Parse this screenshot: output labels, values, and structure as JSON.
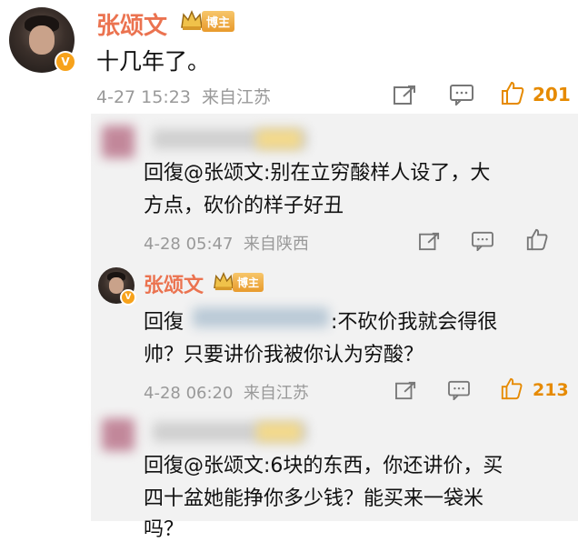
{
  "post": {
    "author": "张颂文",
    "badge": "博主",
    "verified_mark": "V",
    "content": "十几年了。",
    "meta": "4-27 15:23  来自江苏",
    "like_count": "201"
  },
  "replies": [
    {
      "author_blurred": true,
      "content": "回复@张颂文:别在立穷酸样人设了，大方点，砍价的样子好丑",
      "content_line1": "回復@张颂文:别在立穷酸样人设了，大",
      "content_line2": "方点，砍价的样子好丑",
      "meta": "4-28 05:47  来自陕西",
      "like_count": ""
    },
    {
      "author": "张颂文",
      "badge": "博主",
      "verified_mark": "V",
      "content_line1_prefix": "回復",
      "content_line1_suffix": ":不砍价我就会得很",
      "content_line2": "帅？只要讲价我被你认为穷酸？",
      "meta": "4-28 06:20  来自江苏",
      "like_count": "213"
    },
    {
      "author_blurred": true,
      "content_line1": "回復@张颂文:6块的东西，你还讲价，买",
      "content_line2": "四十盆她能挣你多少钱？能买来一袋米",
      "content_line3": "吗？"
    }
  ],
  "icons": {
    "share": "share-icon",
    "comment": "comment-icon",
    "like": "thumbs-up-icon",
    "crown": "crown-icon"
  },
  "colors": {
    "name": "#eb7350",
    "like_active": "#e68a00",
    "meta": "#999999",
    "sub_bg": "#f2f2f2"
  }
}
